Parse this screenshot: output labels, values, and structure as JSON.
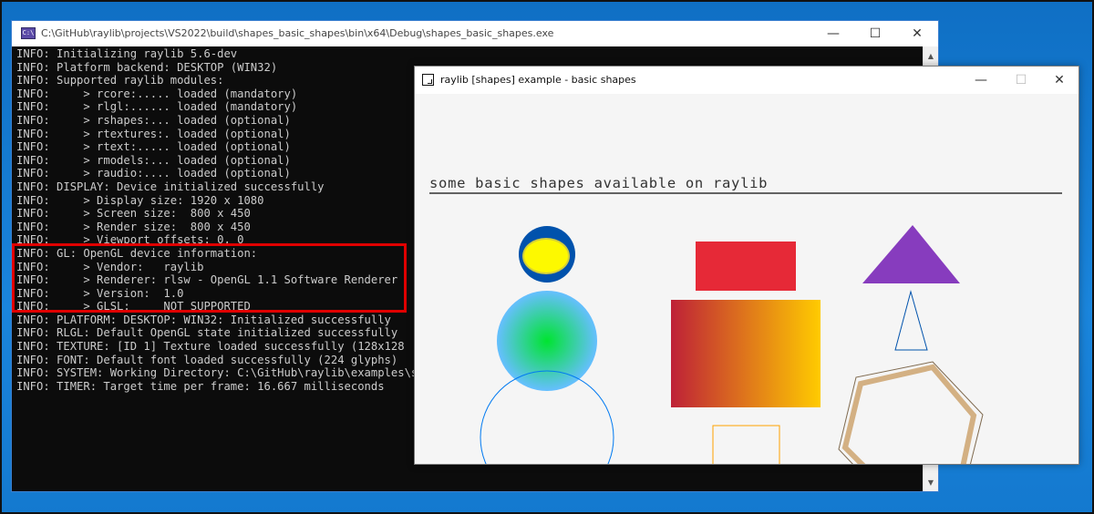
{
  "console": {
    "title": "C:\\GitHub\\raylib\\projects\\VS2022\\build\\shapes_basic_shapes\\bin\\x64\\Debug\\shapes_basic_shapes.exe",
    "icon": "console-app-icon",
    "lines": [
      "INFO: Initializing raylib 5.6-dev",
      "INFO: Platform backend: DESKTOP (WIN32)",
      "INFO: Supported raylib modules:",
      "INFO:     > rcore:..... loaded (mandatory)",
      "INFO:     > rlgl:...... loaded (mandatory)",
      "INFO:     > rshapes:... loaded (optional)",
      "INFO:     > rtextures:. loaded (optional)",
      "INFO:     > rtext:..... loaded (optional)",
      "INFO:     > rmodels:... loaded (optional)",
      "INFO:     > raudio:.... loaded (optional)",
      "INFO: DISPLAY: Device initialized successfully",
      "INFO:     > Display size: 1920 x 1080",
      "INFO:     > Screen size:  800 x 450",
      "INFO:     > Render size:  800 x 450",
      "INFO:     > Viewport offsets: 0, 0",
      "INFO: GL: OpenGL device information:",
      "INFO:     > Vendor:   raylib",
      "INFO:     > Renderer: rlsw - OpenGL 1.1 Software Renderer",
      "INFO:     > Version:  1.0",
      "INFO:     > GLSL:     NOT SUPPORTED",
      "INFO: PLATFORM: DESKTOP: WIN32: Initialized successfully",
      "INFO: RLGL: Default OpenGL state initialized successfully",
      "INFO: TEXTURE: [ID 1] Texture loaded successfully (128x128 | ",
      "INFO: FONT: Default font loaded successfully (224 glyphs)",
      "INFO: SYSTEM: Working Directory: C:\\GitHub\\raylib\\examples\\s",
      "INFO: TIMER: Target time per frame: 16.667 milliseconds"
    ],
    "controls": {
      "minimize": "—",
      "maximize": "☐",
      "close": "✕"
    },
    "scroll": {
      "up": "▲",
      "down": "▼"
    }
  },
  "raylib": {
    "title": "raylib [shapes] example - basic shapes",
    "controls": {
      "minimize": "—",
      "maximize": "☐",
      "close": "✕"
    },
    "heading": "some basic shapes available on raylib"
  },
  "colors": {
    "highlight": "#e00000",
    "circle_outer": "#0052ac",
    "circle_inner": "#fdf900",
    "gradient_center": "#00e430",
    "gradient_edge": "#66bfff",
    "circle_lines": "#0079f1",
    "rect_red": "#e62937",
    "gradient_rect_left": "#be2137",
    "gradient_rect_right": "#ffcb00",
    "rect_lines": "#ffa100",
    "triangle_violet": "#873cbe",
    "triangle_lines": "#0052ac",
    "poly_brown": "#7f6a4f",
    "poly_lines": "#d3b083"
  }
}
